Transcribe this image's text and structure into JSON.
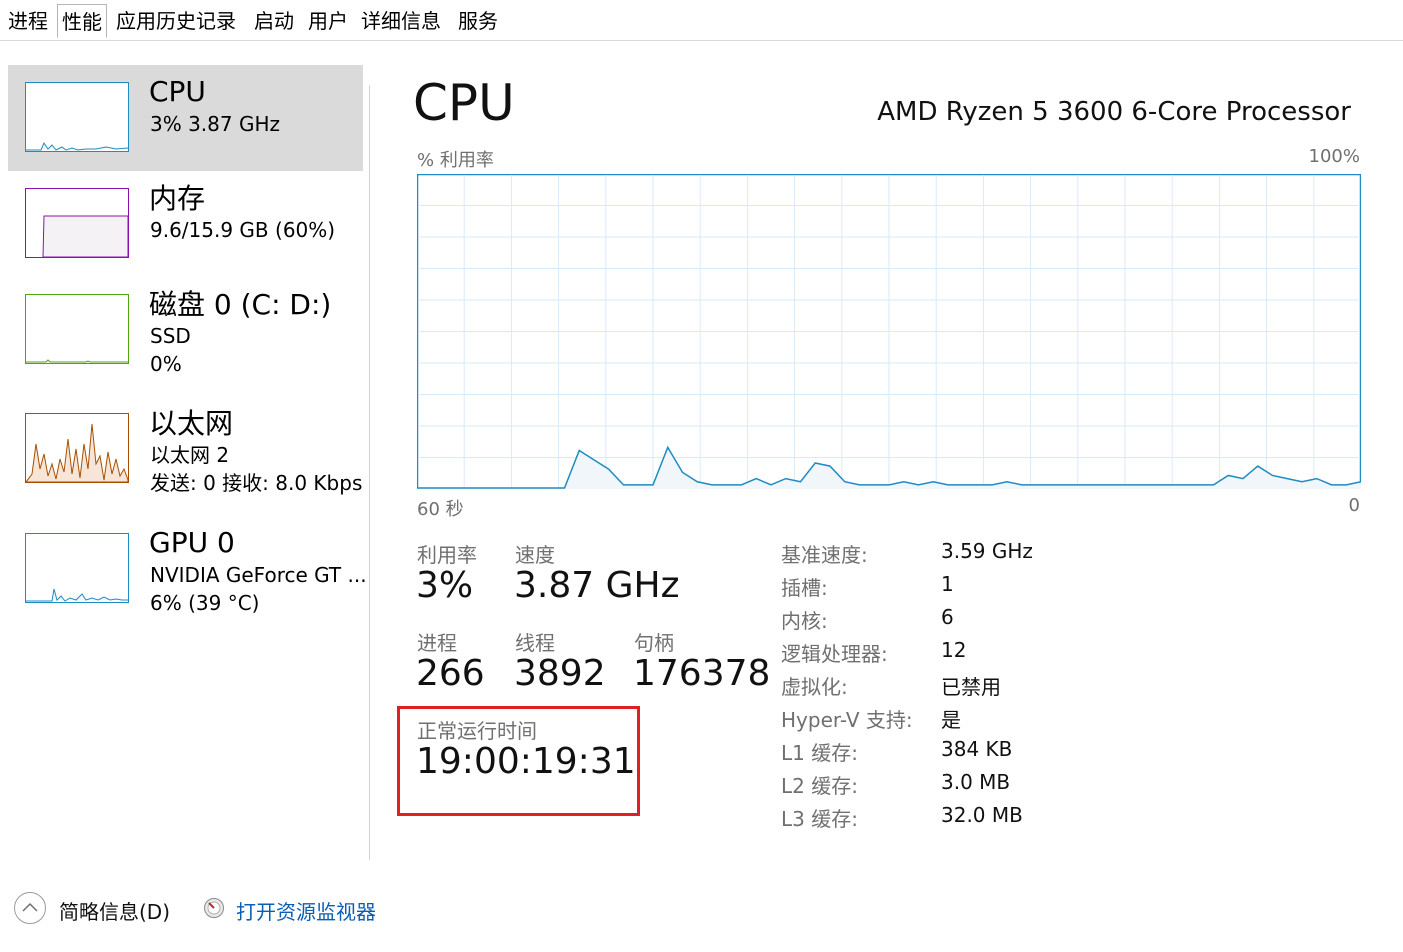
{
  "tabs": [
    "进程",
    "性能",
    "应用历史记录",
    "启动",
    "用户",
    "详细信息",
    "服务"
  ],
  "active_tab": "性能",
  "sidebar": {
    "items": [
      {
        "title": "CPU",
        "line1": "3%  3.87 GHz",
        "line2": "",
        "color": "#1e8bc3"
      },
      {
        "title": "内存",
        "line1": "9.6/15.9 GB (60%)",
        "line2": "",
        "color": "#8b12ae"
      },
      {
        "title": "磁盘 0 (C: D:)",
        "line1": "SSD",
        "line2": "0%",
        "color": "#4da60c"
      },
      {
        "title": "以太网",
        "line1": "以太网 2",
        "line2": "发送: 0 接收: 8.0 Kbps",
        "color": "#a74f01"
      },
      {
        "title": "GPU 0",
        "line1": "NVIDIA GeForce GT ...",
        "line2": "6% (39 °C)",
        "color": "#1e8bc3"
      }
    ]
  },
  "header": {
    "title": "CPU",
    "model": "AMD Ryzen 5 3600 6-Core Processor"
  },
  "graph": {
    "y_label": "% 利用率",
    "y_max_label": "100%",
    "x_left_label": "60 秒",
    "x_right_label": "0",
    "line_color": "#1e8bc3",
    "grid_color": "#d9eaf7",
    "utilization_series_percent": [
      0,
      0,
      0,
      0,
      0,
      0,
      0,
      0,
      0,
      0,
      0,
      12,
      9,
      6,
      1,
      1,
      1,
      13,
      5,
      2,
      1,
      1,
      1,
      3,
      1,
      3,
      2,
      8,
      7,
      2,
      1,
      1,
      1,
      2,
      1,
      2,
      1,
      1,
      1,
      1,
      2,
      1,
      1,
      1,
      1,
      1,
      1,
      1,
      1,
      1,
      1,
      1,
      1,
      1,
      1,
      4,
      3,
      7,
      4,
      3,
      2,
      3,
      1,
      1,
      2
    ]
  },
  "stats": {
    "utilization": {
      "label": "利用率",
      "value": "3%"
    },
    "speed": {
      "label": "速度",
      "value": "3.87 GHz"
    },
    "processes": {
      "label": "进程",
      "value": "266"
    },
    "threads": {
      "label": "线程",
      "value": "3892"
    },
    "handles": {
      "label": "句柄",
      "value": "176378"
    },
    "uptime": {
      "label": "正常运行时间",
      "value": "19:00:19:31"
    }
  },
  "details": [
    {
      "key": "基准速度:",
      "value": "3.59 GHz"
    },
    {
      "key": "插槽:",
      "value": "1"
    },
    {
      "key": "内核:",
      "value": "6"
    },
    {
      "key": "逻辑处理器:",
      "value": "12"
    },
    {
      "key": "虚拟化:",
      "value": "已禁用"
    },
    {
      "key": "Hyper-V 支持:",
      "value": "是"
    },
    {
      "key": "L1 缓存:",
      "value": "384 KB"
    },
    {
      "key": "L2 缓存:",
      "value": "3.0 MB"
    },
    {
      "key": "L3 缓存:",
      "value": "32.0 MB"
    }
  ],
  "highlight_color": "#e02020",
  "footer": {
    "summary_label": "简略信息(D)",
    "monitor_link": "打开资源监视器",
    "link_color": "#0a5fb4"
  }
}
